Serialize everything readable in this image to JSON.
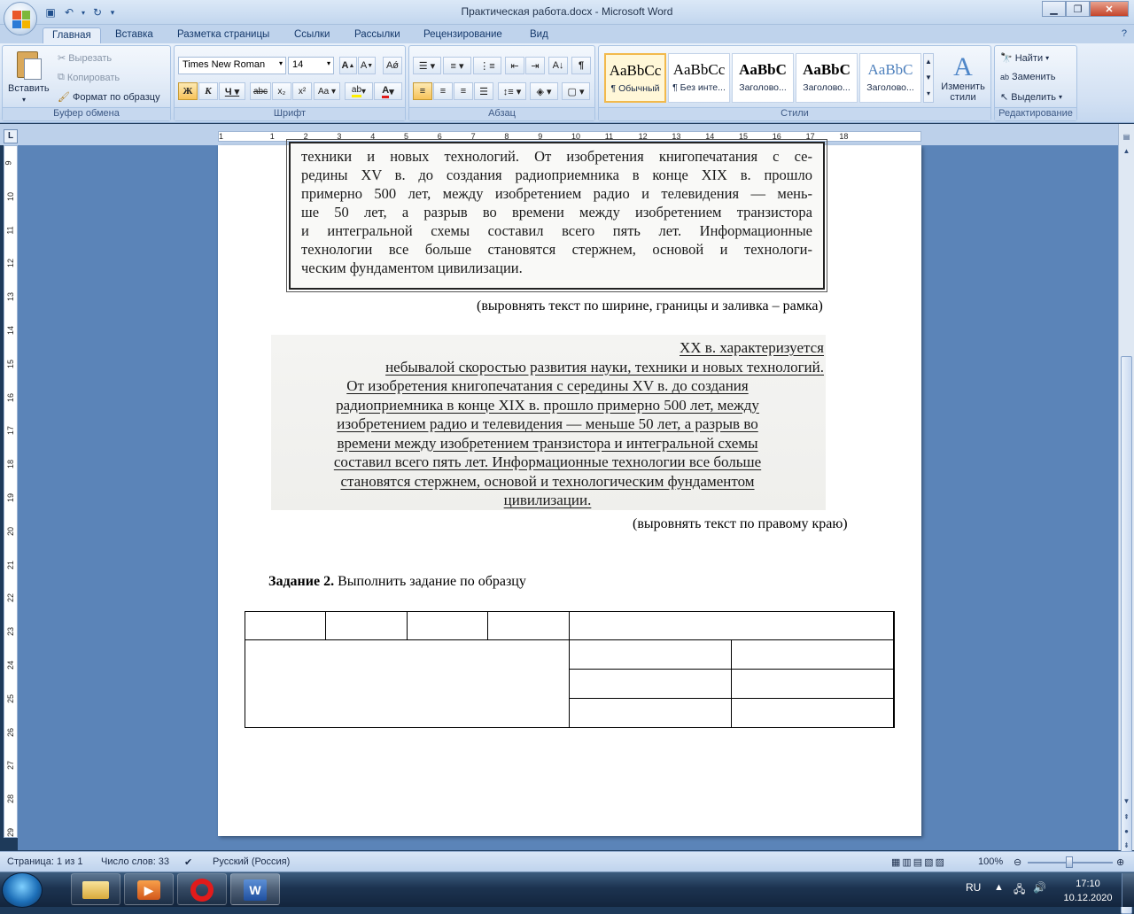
{
  "window": {
    "title": "Практическая работа.docx - Microsoft Word"
  },
  "tabs": [
    "Главная",
    "Вставка",
    "Разметка страницы",
    "Ссылки",
    "Рассылки",
    "Рецензирование",
    "Вид"
  ],
  "ribbon": {
    "clipboard": {
      "label": "Буфер обмена",
      "paste": "Вставить",
      "cut": "Вырезать",
      "copy": "Копировать",
      "format_painter": "Формат по образцу"
    },
    "font": {
      "label": "Шрифт",
      "font_name": "Times New Roman",
      "font_size": "14"
    },
    "paragraph": {
      "label": "Абзац"
    },
    "styles": {
      "label": "Стили",
      "items": [
        {
          "sample": "AaBbCc",
          "name": "¶ Обычный"
        },
        {
          "sample": "AaBbCc",
          "name": "¶ Без инте..."
        },
        {
          "sample": "AaBbC",
          "name": "Заголово..."
        },
        {
          "sample": "AaBbC",
          "name": "Заголово..."
        },
        {
          "sample": "AaBbC",
          "name": "Заголово..."
        }
      ],
      "change_styles": "Изменить стили"
    },
    "editing": {
      "label": "Редактирование",
      "find": "Найти",
      "replace": "Заменить",
      "select": "Выделить"
    }
  },
  "ruler": {
    "h_numbers": [
      "1",
      "1",
      "2",
      "3",
      "4",
      "5",
      "6",
      "7",
      "8",
      "9",
      "10",
      "11",
      "12",
      "13",
      "14",
      "15",
      "16",
      "17",
      "18"
    ],
    "v_numbers": [
      "9",
      "10",
      "11",
      "12",
      "13",
      "14",
      "15",
      "16",
      "17",
      "18",
      "19",
      "20",
      "21",
      "22",
      "23",
      "24",
      "25",
      "26",
      "27",
      "28",
      "29"
    ]
  },
  "document": {
    "frame_lines": [
      "техники и новых технологий. От изобретения книгопечатания с се-",
      "редины XV в. до создания радиоприемника в конце XIX в. прошло",
      "примерно 500 лет, между изобретением радио и телевидения — мень-",
      "ше 50 лет, а разрыв во времени между изобретением транзистора",
      "и интегральной схемы составил всего пять лет. Информационные",
      "технологии все больше становятся стержнем, основой и технологи-",
      "ческим фундаментом цивилизации."
    ],
    "caption1": "(выровнять текст по ширине,  границы и заливка – рамка)",
    "right_lines": [
      "XX в. характеризуется",
      "небывалой скоростью развития науки, техники и новых технологий.",
      "От изобретения книгопечатания с середины XV в. до создания",
      "радиоприемника в конце XIX в. прошло примерно 500 лет, между",
      "изобретением радио и телевидения — меньше 50 лет, а разрыв во",
      "времени между изобретением транзистора и интегральной схемы",
      "составил всего пять лет. Информационные технологии все больше",
      "становятся стержнем, основой и технологическим фундаментом",
      "цивилизации."
    ],
    "caption2": "(выровнять текст по правому краю)",
    "task_bold": "Задание 2.",
    "task_text": " Выполнить задание по образцу"
  },
  "status": {
    "page": "Страница: 1 из 1",
    "words": "Число слов: 33",
    "language": "Русский (Россия)",
    "zoom": "100%"
  },
  "taskbar": {
    "lang": "RU",
    "time": "17:10",
    "date": "10.12.2020"
  }
}
